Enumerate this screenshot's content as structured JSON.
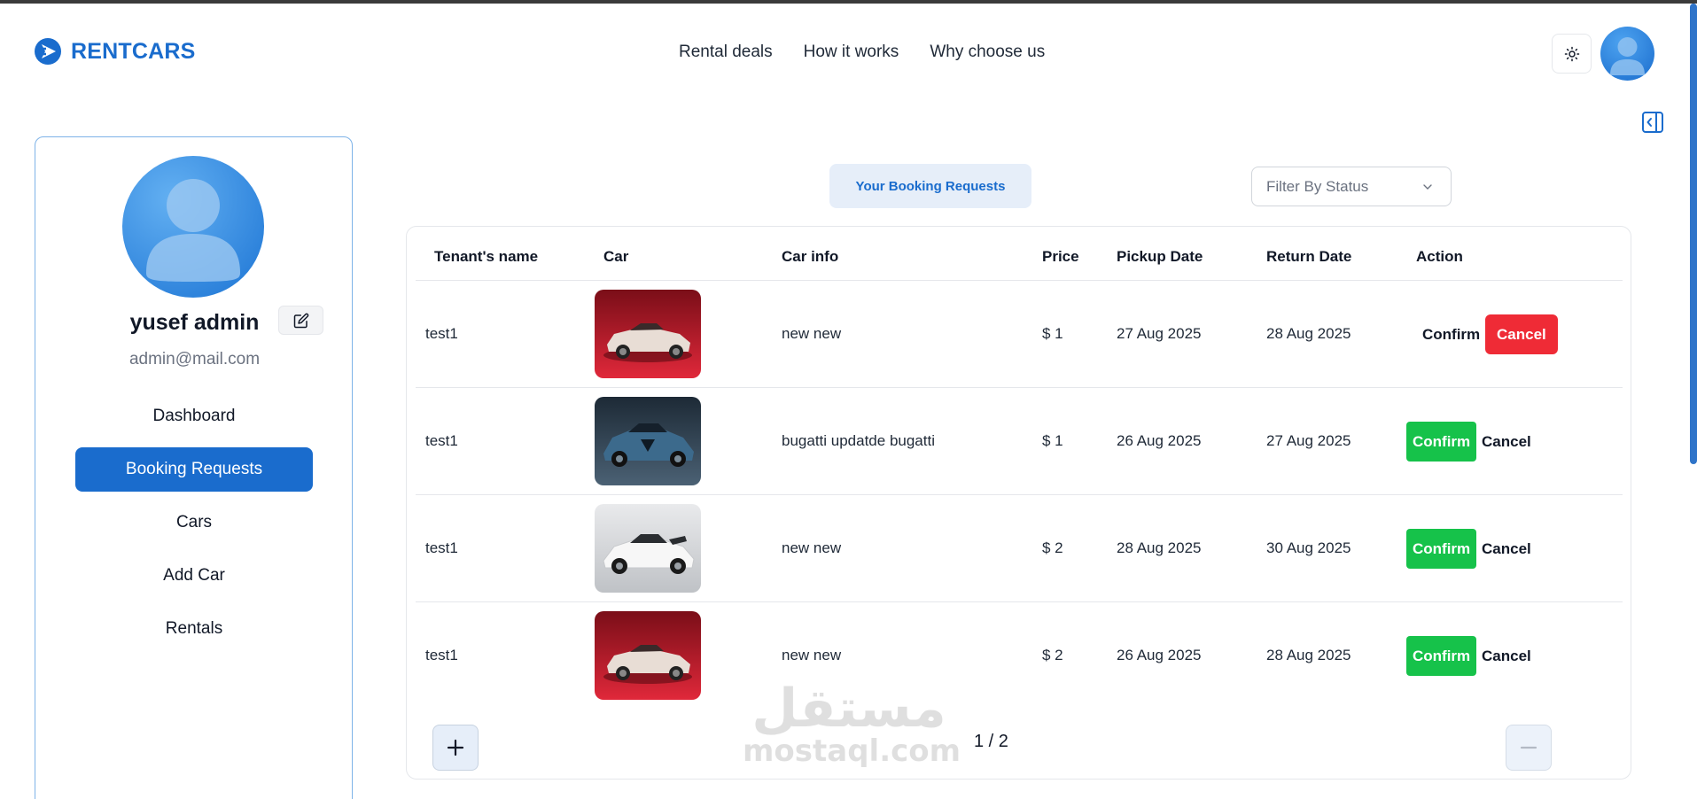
{
  "app": {
    "logo_text": "RENTCARS"
  },
  "nav": {
    "links": [
      "Rental deals",
      "How it works",
      "Why choose us"
    ]
  },
  "sidebar": {
    "name": "yusef admin",
    "email": "admin@mail.com",
    "items": [
      {
        "label": "Dashboard",
        "active": false
      },
      {
        "label": "Booking Requests",
        "active": true
      },
      {
        "label": "Cars",
        "active": false
      },
      {
        "label": "Add Car",
        "active": false
      },
      {
        "label": "Rentals",
        "active": false
      }
    ]
  },
  "main": {
    "tab_label": "Your Booking Requests",
    "filter_placeholder": "Filter By Status",
    "columns": [
      "Tenant's name",
      "Car",
      "Car info",
      "Price",
      "Pickup Date",
      "Return Date",
      "Action"
    ],
    "rows": [
      {
        "tenant": "test1",
        "car_image": "red-convertible",
        "info": "new new",
        "price": "$ 1",
        "pickup": "27 Aug 2025",
        "return": "28 Aug 2025",
        "confirm": "Confirm",
        "cancel": "Cancel",
        "active_action": "cancel"
      },
      {
        "tenant": "test1",
        "car_image": "blue-bugatti",
        "info": "bugatti updatde bugatti",
        "price": "$ 1",
        "pickup": "26 Aug 2025",
        "return": "27 Aug 2025",
        "confirm": "Confirm",
        "cancel": "Cancel",
        "active_action": "confirm"
      },
      {
        "tenant": "test1",
        "car_image": "white-hypercar",
        "info": "new new",
        "price": "$ 2",
        "pickup": "28 Aug 2025",
        "return": "30 Aug 2025",
        "confirm": "Confirm",
        "cancel": "Cancel",
        "active_action": "confirm"
      },
      {
        "tenant": "test1",
        "car_image": "red-convertible",
        "info": "new new",
        "price": "$ 2",
        "pickup": "26 Aug 2025",
        "return": "28 Aug 2025",
        "confirm": "Confirm",
        "cancel": "Cancel",
        "active_action": "confirm"
      }
    ],
    "pagination": {
      "text": "1 / 2",
      "prev_icon": "plus-icon",
      "next_icon": "minus-icon"
    }
  },
  "watermark": {
    "arabic": "مستقل",
    "latin": "mostaql.com"
  },
  "colors": {
    "brand": "#1a6ccd",
    "confirm": "#16c24a",
    "cancel": "#ef2b36"
  }
}
